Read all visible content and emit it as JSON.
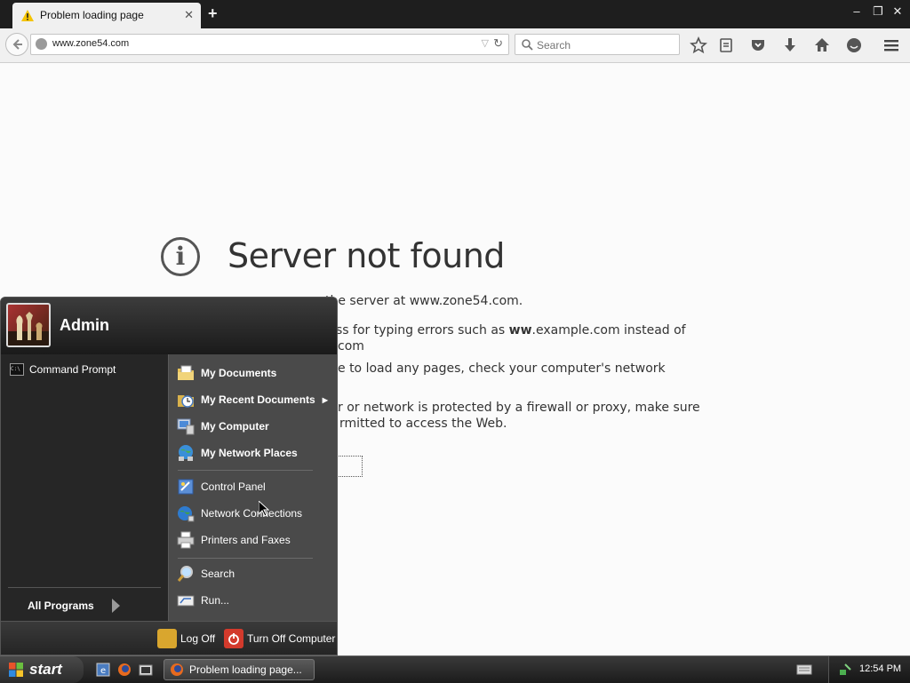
{
  "browser": {
    "tab_title": "Problem loading page",
    "tab_close": "✕",
    "new_tab": "+",
    "window_controls": {
      "minimize": "–",
      "restore": "❐",
      "close": "✕"
    },
    "url": "www.zone54.com",
    "search_placeholder": "Search",
    "toolbar_icons": [
      "bookmark-star-icon",
      "reading-list-icon",
      "pocket-icon",
      "download-icon",
      "home-icon",
      "chat-icon",
      "menu-icon"
    ]
  },
  "error_page": {
    "title": "Server not found",
    "lines": [
      "the server at www.zone54.com.",
      "ss for typing errors such as ",
      "ww",
      ".example.com instead of",
      "com",
      "e to load any pages, check your computer's network",
      "r or network is protected by a firewall or proxy, make sure",
      "rmitted to access the Web."
    ]
  },
  "start_menu": {
    "username": "Admin",
    "pinned": [
      {
        "label": "Command Prompt",
        "icon": "command-prompt-icon"
      }
    ],
    "all_programs": "All Programs",
    "right_items": [
      {
        "label": "My Documents",
        "icon": "my-documents-icon",
        "bold": true
      },
      {
        "label": "My Recent Documents",
        "icon": "recent-documents-icon",
        "bold": true,
        "submenu": true
      },
      {
        "label": "My Computer",
        "icon": "my-computer-icon",
        "bold": true
      },
      {
        "label": "My Network Places",
        "icon": "network-places-icon",
        "bold": true
      },
      {
        "label": "Control Panel",
        "icon": "control-panel-icon",
        "bold": false
      },
      {
        "label": "Network Connections",
        "icon": "network-connections-icon",
        "bold": false
      },
      {
        "label": "Printers and Faxes",
        "icon": "printers-icon",
        "bold": false
      },
      {
        "label": "Search",
        "icon": "search-icon",
        "bold": false
      },
      {
        "label": "Run...",
        "icon": "run-icon",
        "bold": false
      }
    ],
    "log_off": "Log Off",
    "turn_off": "Turn Off Computer"
  },
  "taskbar": {
    "start_label": "start",
    "task_button": "Problem loading page...",
    "clock": "12:54 PM"
  },
  "colors": {
    "taskbar": "#2a2a2a",
    "start_menu_right": "#4a4a4a",
    "warning": "#f5c400"
  }
}
